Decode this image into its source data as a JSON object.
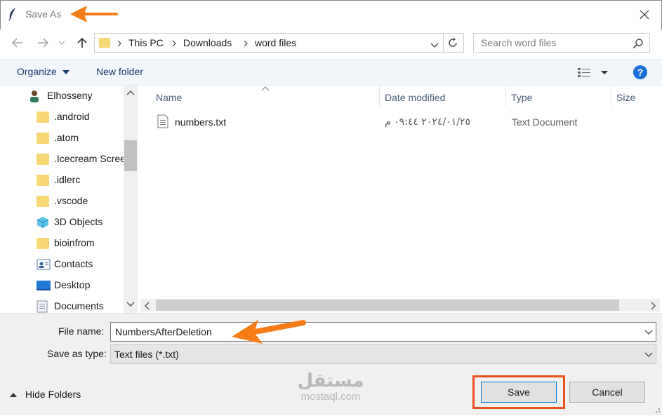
{
  "window": {
    "title": "Save As"
  },
  "address": {
    "crumbs": [
      "This PC",
      "Downloads",
      "word files"
    ]
  },
  "search": {
    "placeholder": "Search word files"
  },
  "toolbar": {
    "organize": "Organize",
    "new_folder": "New folder",
    "help": "?"
  },
  "nav": {
    "items": [
      {
        "label": "Elhosseny",
        "icon": "user-icon"
      },
      {
        "label": ".android",
        "icon": "folder-icon"
      },
      {
        "label": ".atom",
        "icon": "folder-icon"
      },
      {
        "label": ".Icecream Scree",
        "icon": "folder-icon"
      },
      {
        "label": ".idlerc",
        "icon": "folder-icon"
      },
      {
        "label": ".vscode",
        "icon": "folder-icon"
      },
      {
        "label": "3D Objects",
        "icon": "cube-icon"
      },
      {
        "label": "bioinfrom",
        "icon": "folder-icon"
      },
      {
        "label": "Contacts",
        "icon": "contacts-icon"
      },
      {
        "label": "Desktop",
        "icon": "desktop-icon"
      },
      {
        "label": "Documents",
        "icon": "documents-icon"
      }
    ]
  },
  "columns": {
    "name": "Name",
    "date": "Date modified",
    "type": "Type",
    "size": "Size"
  },
  "files": [
    {
      "name": "numbers.txt",
      "date": "٢٠٢٤/٠١/٢٥ ٠٩:٤٤ م",
      "type": "Text Document"
    }
  ],
  "form": {
    "file_name_label": "File name:",
    "file_name_value": "NumbersAfterDeletion",
    "save_type_label": "Save as type:",
    "save_type_value": "Text files (*.txt)"
  },
  "footer": {
    "hide_folders": "Hide Folders",
    "save": "Save",
    "cancel": "Cancel"
  },
  "watermark": {
    "arabic": "مستقل",
    "latin": "mostaql.com"
  },
  "colors": {
    "accent": "#0078d7",
    "annotation": "#f57c16",
    "highlight_box": "#e9511c",
    "folder": "#f8d775"
  }
}
